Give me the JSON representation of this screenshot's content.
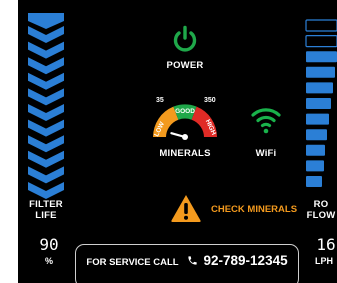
{
  "colors": {
    "panel_bg": "#000000",
    "accent_blue": "#2b7fd6",
    "power_green": "#1fa84a",
    "wifi_green": "#19b24b",
    "warning_orange": "#f39a1e",
    "gauge_low": "#f39a1e",
    "gauge_good": "#1fa84a",
    "gauge_high": "#e02b26"
  },
  "power": {
    "icon": "power-icon",
    "label": "POWER"
  },
  "minerals": {
    "label": "MINERALS",
    "scale_min": "35",
    "scale_max": "350",
    "zones": [
      "LOW",
      "GOOD",
      "HIGH"
    ],
    "needle_level": 0.25
  },
  "wifi": {
    "icon": "wifi-icon",
    "label": "WiFi"
  },
  "alert": {
    "icon": "warning-icon",
    "text": "CHECK MINERALS"
  },
  "filter_life": {
    "label_line1": "FILTER",
    "label_line2": "LIFE",
    "value": "90",
    "unit": "%",
    "segments": 11
  },
  "ro_flow": {
    "label_line1": "RO",
    "label_line2": "FLOW",
    "value": "16",
    "unit": "LPH",
    "segments_total": 11,
    "segments_lit": 9
  },
  "service": {
    "label": "FOR SERVICE CALL",
    "phone_icon": "phone-icon",
    "phone": "92-789-12345"
  }
}
